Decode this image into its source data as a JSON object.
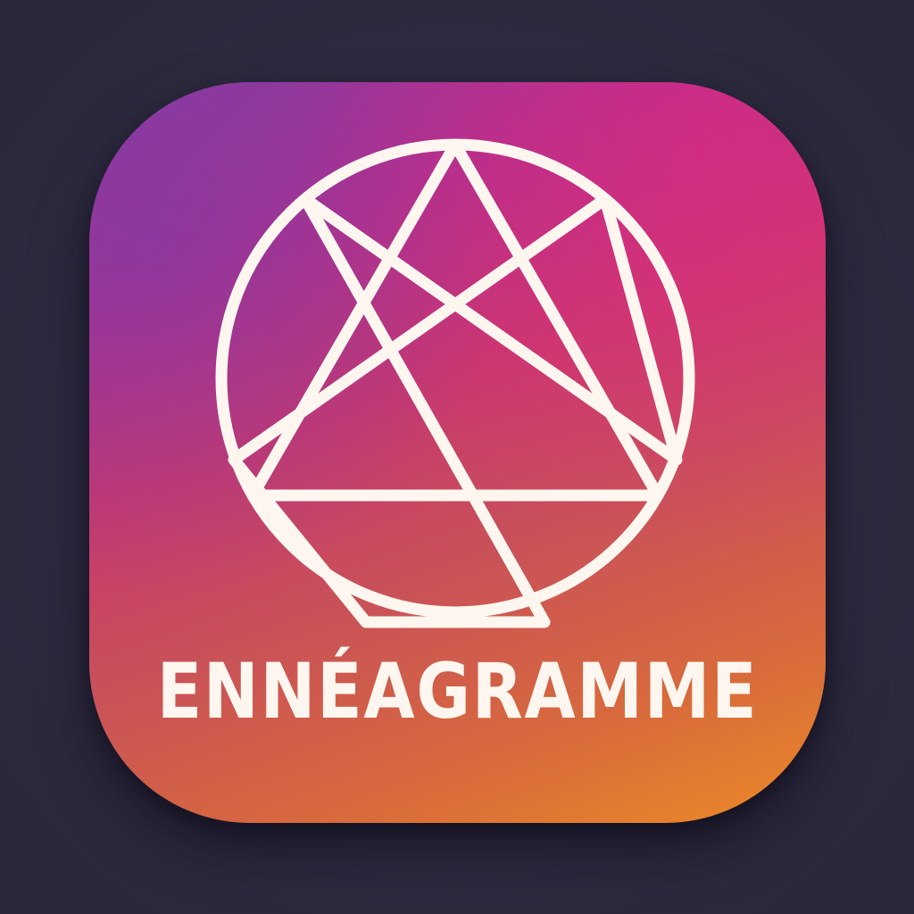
{
  "app": {
    "title": "ENNÉAGRAMME",
    "icon": "enneagram-icon",
    "colors": {
      "background": "#2e2b40",
      "gradient_top_left": "#8a3aa0",
      "gradient_top_right": "#d6307a",
      "gradient_bottom_right": "#ec8a25",
      "symbol": "#fff7ef"
    }
  }
}
